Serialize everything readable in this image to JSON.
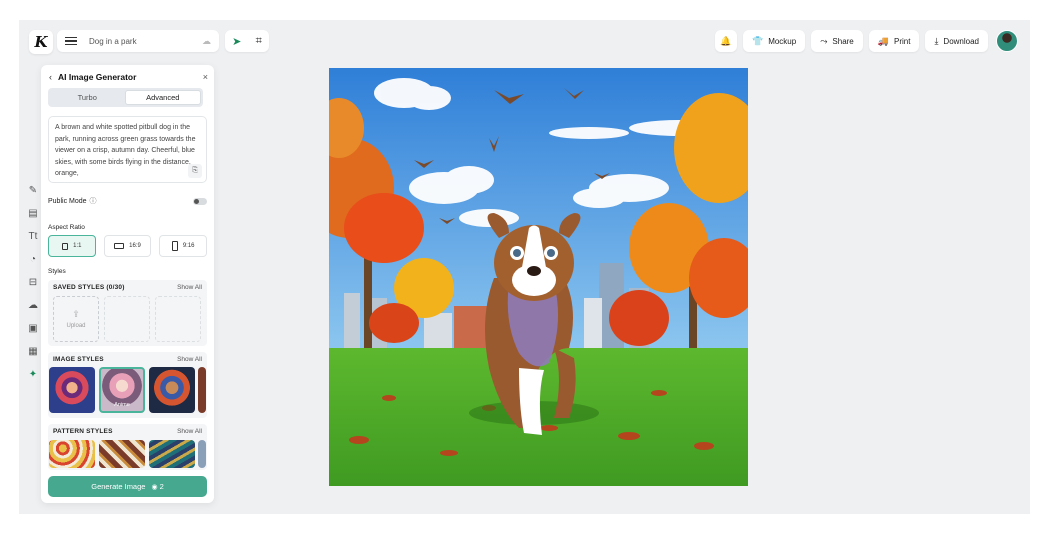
{
  "logo": "K",
  "document": {
    "title": "Dog in a park"
  },
  "toolbar": {
    "mockup_label": "Mockup",
    "share_label": "Share",
    "print_label": "Print",
    "download_label": "Download"
  },
  "panel": {
    "title": "AI Image Generator",
    "tabs": [
      "Turbo",
      "Advanced"
    ],
    "active_tab": "Advanced",
    "prompt": "A brown and white spotted pitbull dog in the park, running across green grass towards the viewer on a crisp, autumn day. Cheerful, blue skies, with some birds flying in the distance, orange,",
    "public_mode_label": "Public Mode",
    "public_mode_on": false,
    "aspect_ratio_label": "Aspect Ratio",
    "aspect_ratios": [
      "1:1",
      "16:9",
      "9:16"
    ],
    "selected_ratio": "1:1",
    "styles_label": "Styles",
    "saved_styles": {
      "title": "SAVED STYLES (0/30)",
      "show_all": "Show All",
      "upload_label": "Upload"
    },
    "image_styles": {
      "title": "IMAGE STYLES",
      "show_all": "Show All",
      "selected_caption": "Anime"
    },
    "pattern_styles": {
      "title": "PATTERN STYLES",
      "show_all": "Show All"
    },
    "generate_label": "Generate Image",
    "generate_credits": "2"
  },
  "colors": {
    "accent": "#46a88f",
    "alert": "#e0453a"
  }
}
